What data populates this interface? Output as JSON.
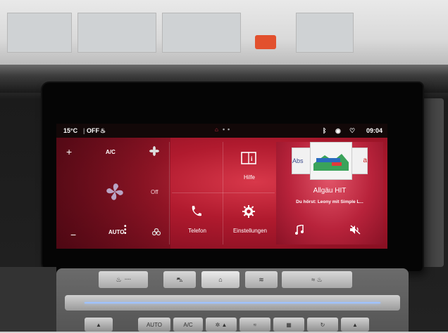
{
  "statusbar": {
    "temperature": "15°C",
    "fan_state": "OFF",
    "time": "09:04",
    "page_dots": [
      "home",
      "dot",
      "dot"
    ]
  },
  "climate": {
    "plus_label": "+",
    "ac_label": "A/C",
    "minus_label": "−",
    "auto_label": "AUTO",
    "fan_status": "Off"
  },
  "shortcuts": {
    "help_label": "Hilfe",
    "phone_label": "Telefon",
    "settings_label": "Einstellungen"
  },
  "radio": {
    "station": "Allgäu HIT",
    "now_playing": "Du hörst: Leony mit Simple L...",
    "logo_left": "Abs",
    "logo_right": "a"
  },
  "console": {
    "row1": [
      "",
      "",
      "",
      "",
      "",
      ""
    ],
    "row2": [
      "",
      "AUTO",
      "A/C",
      "",
      "",
      "",
      ""
    ]
  },
  "colors": {
    "accent": "#c8203a",
    "screen_bg": "#0c0608"
  }
}
